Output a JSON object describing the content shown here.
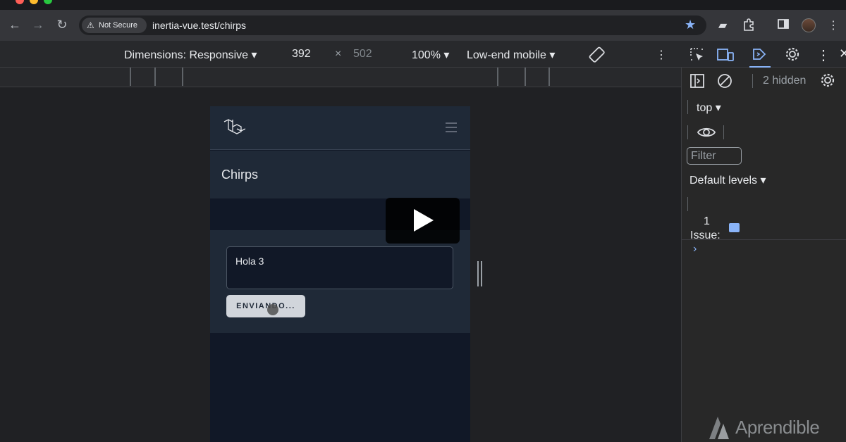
{
  "browser": {
    "security_chip": "Not Secure",
    "url": "inertia-vue.test/chirps"
  },
  "device_toolbar": {
    "dimensions_label": "Dimensions: Responsive",
    "width": "392",
    "times": "×",
    "height": "502",
    "zoom": "100%",
    "throttle": "Low-end mobile"
  },
  "app": {
    "page_title": "Chirps",
    "textarea_value": "Hola 3",
    "submit_label": "ENVIANDO..."
  },
  "devtools": {
    "hidden_count": "2 hidden",
    "context": "top",
    "filter_placeholder": "Filter",
    "levels": "Default levels",
    "issue_count": "1",
    "issue_label": "Issue:",
    "prompt": "›"
  },
  "watermark": "Aprendible",
  "icons": [
    "back-arrow-icon",
    "forward-arrow-icon",
    "reload-icon",
    "warning-icon",
    "star-icon",
    "extension-icon",
    "puzzle-icon",
    "sidebar-icon",
    "kebab-menu-icon",
    "rotate-icon",
    "inspect-icon",
    "device-icon",
    "sources-icon",
    "settings-icon",
    "close-icon",
    "panel-toggle-icon",
    "clear-icon",
    "eye-icon",
    "message-icon",
    "laravel-logo-icon",
    "hamburger-icon",
    "play-icon"
  ],
  "colors": {
    "accent": "#8ab4f8",
    "app_bg": "#111827",
    "card_bg": "#1f2937"
  }
}
